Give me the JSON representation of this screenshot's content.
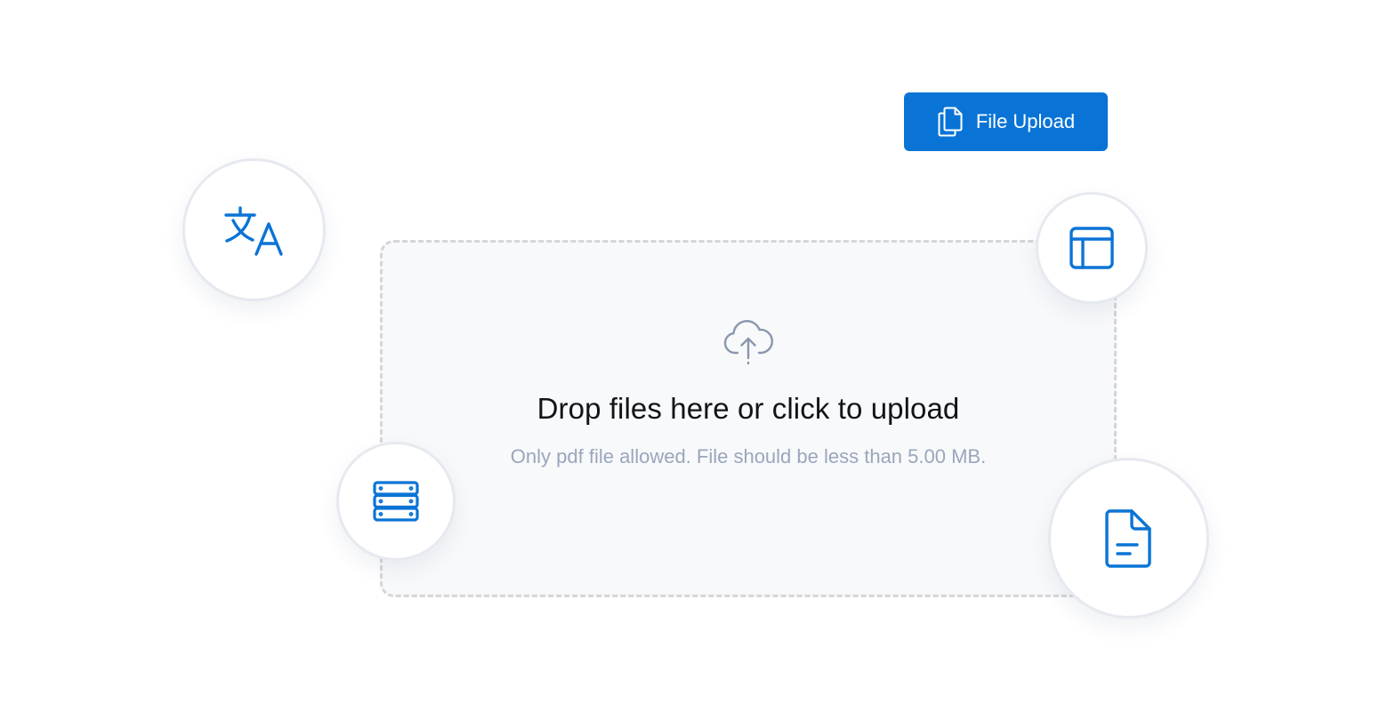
{
  "upload_button": {
    "label": "File Upload",
    "icon": "copy-files-icon"
  },
  "dropzone": {
    "icon": "cloud-upload-icon",
    "title": "Drop files here or click to upload",
    "hint": "Only pdf file allowed. File should be less than 5.00 MB."
  },
  "floating_icons": [
    "translate-icon",
    "layout-icon",
    "server-icon",
    "document-icon"
  ],
  "colors": {
    "accent": "#0a74d6",
    "dropzone_bg": "#f8f9fb",
    "dropzone_border": "#d6d6d8",
    "hint_text": "#9aa6bb",
    "title_text": "#111418",
    "icon_gray": "#8a97ad"
  }
}
